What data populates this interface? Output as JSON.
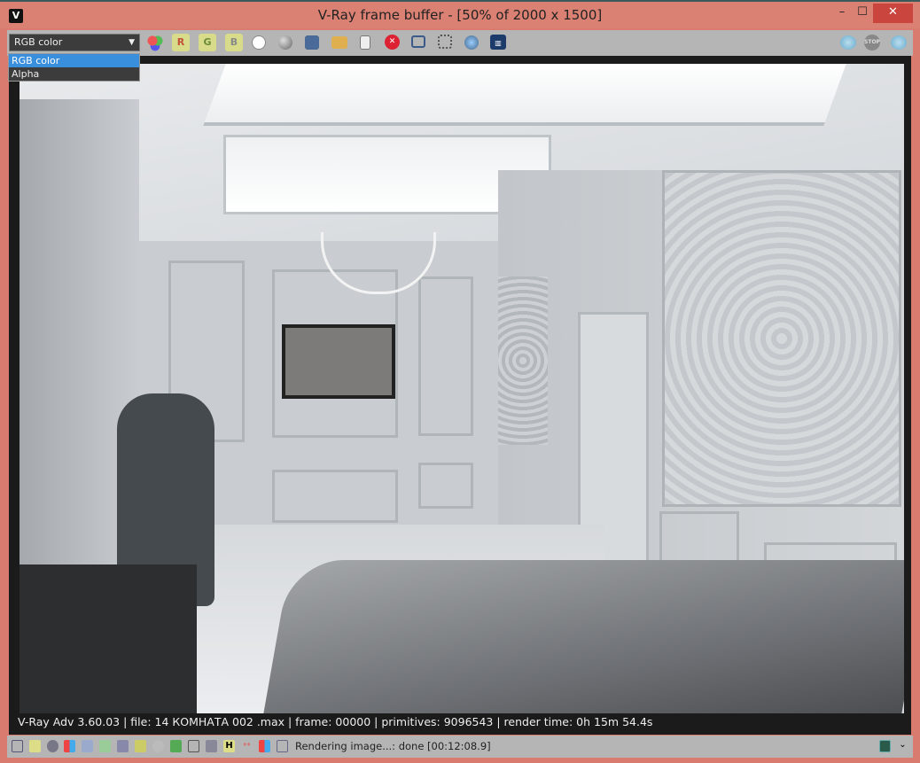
{
  "window": {
    "title": "V-Ray frame buffer - [50% of 2000 x 1500]",
    "minimize": "–",
    "maximize": "☐",
    "close": "✕"
  },
  "toolbar": {
    "channel_select": {
      "value": "RGB color",
      "options": [
        "RGB color",
        "Alpha"
      ]
    },
    "buttons": [
      {
        "name": "rgb-channels-icon",
        "label": ""
      },
      {
        "name": "red-channel-button",
        "label": "R"
      },
      {
        "name": "green-channel-button",
        "label": "G"
      },
      {
        "name": "blue-channel-button",
        "label": "B"
      }
    ],
    "stop_label": "STOP"
  },
  "render": {
    "info": "V-Ray Adv 3.60.03 | file: 14 КОМНАТА 002 .max | frame: 00000 | primitives: 9096543 | render time:  0h 15m 54.4s"
  },
  "statusbar": {
    "text": "Rendering image...: done [00:12:08.9]",
    "h_label": "H"
  },
  "colors": {
    "frame": "#db8173",
    "toolbar": "#b5b5b5",
    "selected": "#3a8fdc",
    "close": "#c9453e"
  }
}
